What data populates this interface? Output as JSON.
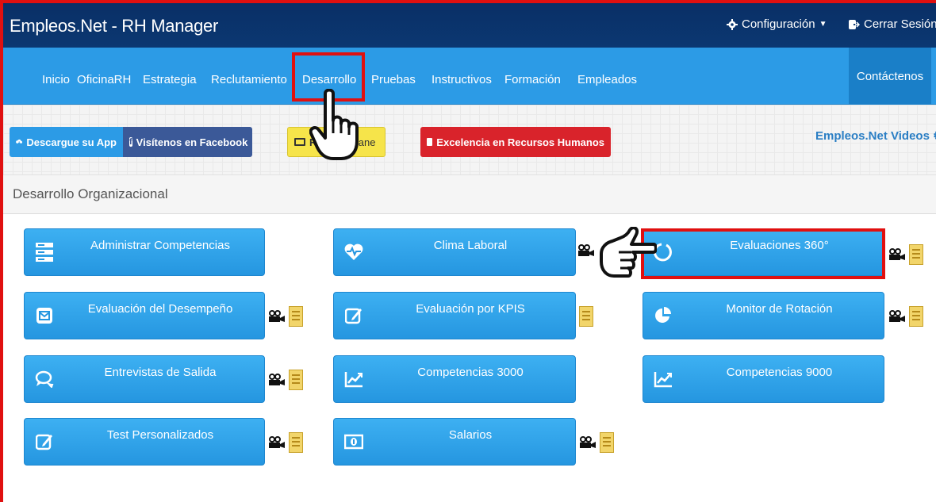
{
  "header": {
    "title": "Empleos.Net - RH Manager",
    "config_label": "Configuración",
    "logout_label": "Cerrar Sesión"
  },
  "nav": {
    "items": [
      "Inicio",
      "OficinaRH",
      "Estrategia",
      "Reclutamiento",
      "Desarrollo",
      "Pruebas",
      "Instructivos",
      "Formación",
      "Empleados"
    ],
    "contact": "Contáctenos"
  },
  "toolbar": {
    "app": "Descargue su App",
    "facebook": "Visítenos en Facebook",
    "gane_left": "Re",
    "gane_right": "Gane",
    "excelencia": "Excelencia en Recursos Humanos",
    "videos": "Empleos.Net Videos"
  },
  "panel": {
    "title": "Desarrollo Organizacional"
  },
  "tiles": {
    "t1": "Administrar Competencias",
    "t2": "Clima Laboral",
    "t3": "Evaluaciones 360°",
    "t4": "Evaluación del Desempeño",
    "t5": "Evaluación por KPIS",
    "t6": "Monitor de Rotación",
    "t7": "Entrevistas de Salida",
    "t8": "Competencias 3000",
    "t9": "Competencias 9000",
    "t10": "Test Personalizados",
    "t11": "Salarios"
  },
  "colors": {
    "nav_blue": "#2c9be6",
    "header_navy": "#0b3872",
    "highlight_red": "#e01010"
  }
}
